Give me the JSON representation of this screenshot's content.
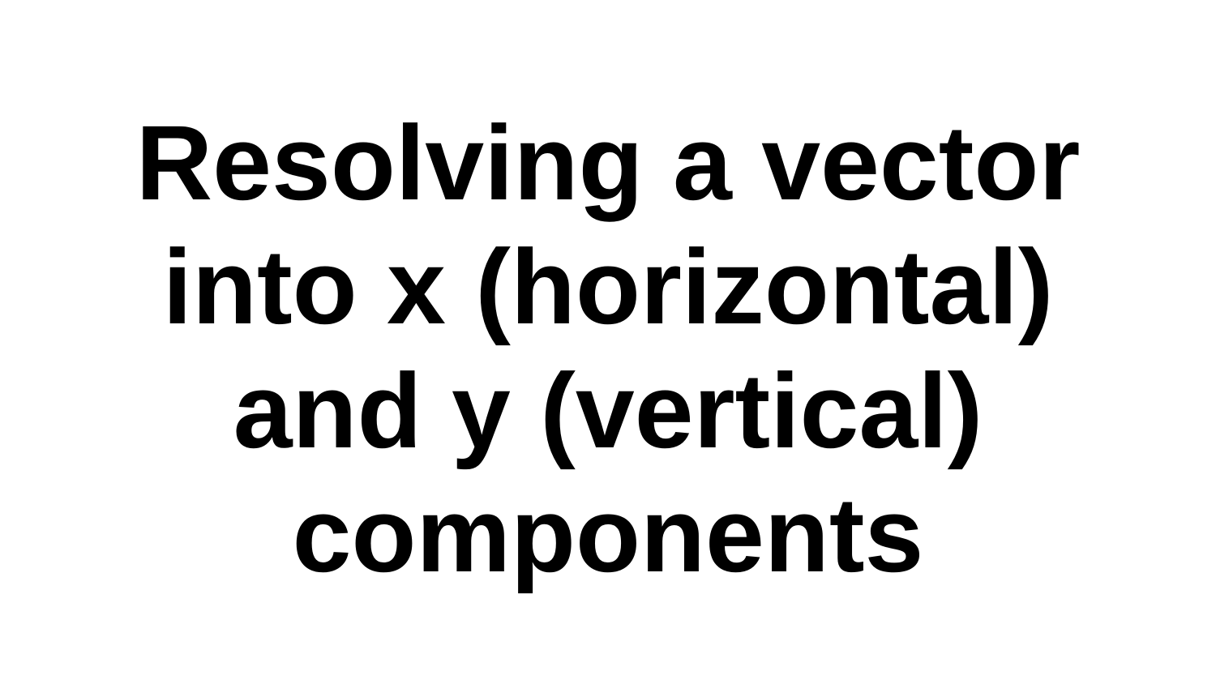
{
  "slide": {
    "title_lines": [
      "Resolving a vector",
      "into x (horizontal)",
      "and y (vertical)",
      "components"
    ]
  },
  "colors": {
    "background": "#ffffff",
    "text": "#000000"
  }
}
